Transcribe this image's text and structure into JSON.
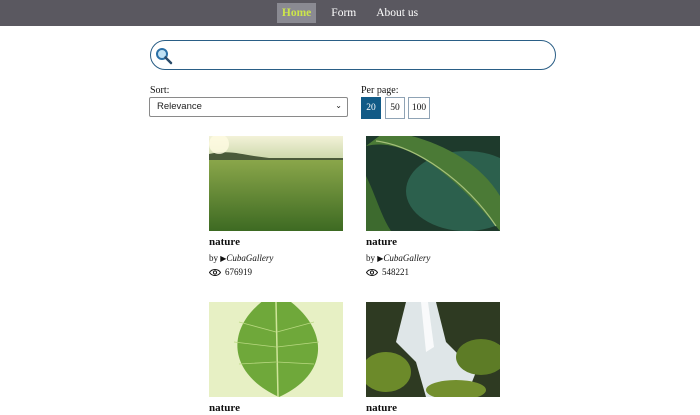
{
  "nav": {
    "items": [
      {
        "label": "Home",
        "active": true
      },
      {
        "label": "Form"
      },
      {
        "label": "About us"
      }
    ]
  },
  "search": {
    "placeholder": "",
    "value": ""
  },
  "sort": {
    "label": "Sort:",
    "selected": "Relevance"
  },
  "per_page": {
    "label": "Per page:",
    "options": [
      "20",
      "50",
      "100"
    ],
    "selected": "20"
  },
  "cards": [
    {
      "title": "nature",
      "by": "by",
      "author": "CubaGallery",
      "views": "676919",
      "image": "grass-field-sunrise"
    },
    {
      "title": "nature",
      "by": "by",
      "author": "CubaGallery",
      "views": "548221",
      "image": "leaf-closeup-teal"
    },
    {
      "title": "nature",
      "image": "green-leaf-backlit"
    },
    {
      "title": "nature",
      "image": "waterfall-moss"
    }
  ],
  "colors": {
    "nav_bg": "#5a5860",
    "nav_active_text": "#cce64a",
    "accent": "#115a86"
  }
}
